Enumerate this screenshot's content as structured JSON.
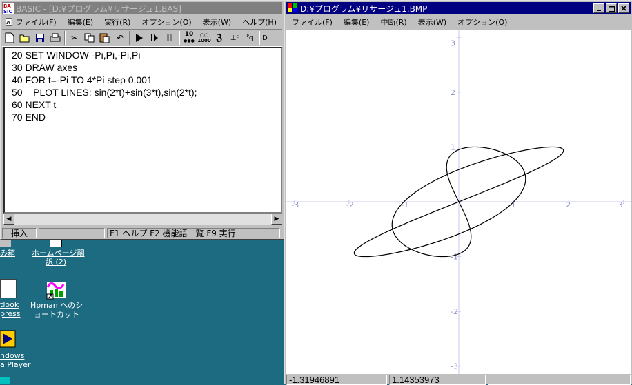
{
  "basic_window": {
    "title": "BASIC - [D:¥プログラム¥リサージュ1.BAS]",
    "menu": [
      "ファイル(F)",
      "編集(E)",
      "実行(R)",
      "オプション(O)",
      "表示(W)",
      "ヘルプ(H)"
    ],
    "code_lines": [
      "20 SET WINDOW -Pi,Pi,-Pi,Pi",
      "30 DRAW axes",
      "40 FOR t=-Pi TO 4*Pi step 0.001",
      "50    PLOT LINES: sin(2*t)+sin(3*t),sin(2*t);",
      "60 NEXT t",
      "70 END"
    ],
    "status": {
      "mode": "挿入",
      "empty": "",
      "hints": "F1 ヘルプ  F2 機能語一覧  F9 実行"
    },
    "toolbar_icons": [
      "new-file-icon",
      "open-folder-icon",
      "save-icon",
      "print-icon",
      "cut-icon",
      "copy-icon",
      "paste-icon",
      "undo-icon",
      "run-icon",
      "step-icon",
      "pause-icon",
      "base10-icon",
      "base1000-icon",
      "debug-icon",
      "set-icon",
      "pq-icon"
    ],
    "toolbar_labels": {
      "base10": "10",
      "base1000": "1000"
    }
  },
  "desktop_icons": [
    {
      "label": "み箱"
    },
    {
      "label": "ホームページ翻\n訳 (2)"
    },
    {
      "label": "tlook\npress"
    },
    {
      "label": "Hpman へのシ\nョートカット"
    },
    {
      "label": "ndows\na Player"
    }
  ],
  "plot_window": {
    "title": "D:¥プログラム¥リサージュ1.BMP",
    "menu": [
      "ファイル(F)",
      "編集(E)",
      "中断(R)",
      "表示(W)",
      "オプション(O)"
    ],
    "status_x": "-1.31946891",
    "status_y": "1.14353973",
    "colors": {
      "axes": "#c8c8f0",
      "curve": "#000000",
      "title_active": "#000080"
    }
  },
  "chart_data": {
    "type": "line",
    "x_range": [
      -3.14159,
      3.14159
    ],
    "y_range": [
      -3.14159,
      3.14159
    ],
    "x_ticks": [
      -3,
      -2,
      -1,
      1,
      2,
      3
    ],
    "y_ticks": [
      3,
      2,
      1,
      -1,
      -2,
      -3
    ],
    "tick_labels_x": [
      "-3",
      "-2",
      "-1",
      "1",
      "2",
      "3"
    ],
    "tick_labels_y": [
      "3",
      "2",
      "1",
      "-1",
      "-2",
      "-3"
    ],
    "series": [
      {
        "x_expr": "sin(2*t)+sin(3*t)",
        "y_expr": "sin(2*t)",
        "t_range": [
          -3.14159,
          12.56637
        ],
        "t_step": 0.001
      }
    ]
  }
}
